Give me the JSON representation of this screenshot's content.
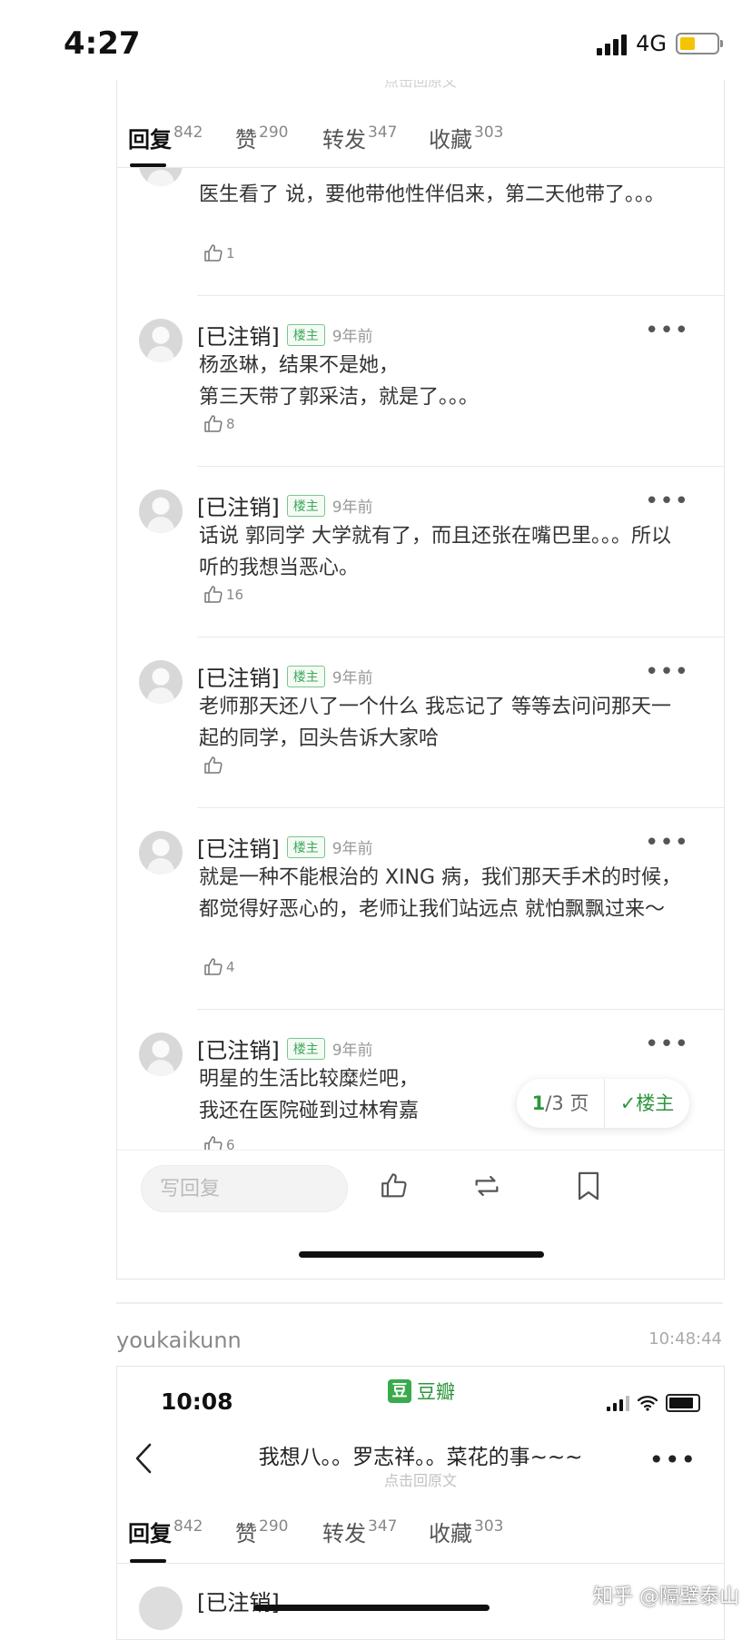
{
  "status_bar": {
    "time": "4:27",
    "network": "4G"
  },
  "ghost_link": "点击回原文",
  "tabs": [
    {
      "label": "回复",
      "count": "842"
    },
    {
      "label": "赞",
      "count": "290"
    },
    {
      "label": "转发",
      "count": "347"
    },
    {
      "label": "收藏",
      "count": "303"
    }
  ],
  "comments": [
    {
      "text": "医生看了 说，要他带他性伴侣来，第二天他带了。。。",
      "likes": "1"
    },
    {
      "name": "[已注销]",
      "badge": "楼主",
      "time": "9年前",
      "text": "杨丞琳，结果不是她，\n第三天带了郭采洁，就是了。。。",
      "likes": "8"
    },
    {
      "name": "[已注销]",
      "badge": "楼主",
      "time": "9年前",
      "text": "话说 郭同学 大学就有了，而且还张在嘴巴里。。。所以听的我想当恶心。",
      "likes": "16"
    },
    {
      "name": "[已注销]",
      "badge": "楼主",
      "time": "9年前",
      "text": "老师那天还八了一个什么 我忘记了 等等去问问那天一起的同学，回头告诉大家哈",
      "likes": ""
    },
    {
      "name": "[已注销]",
      "badge": "楼主",
      "time": "9年前",
      "text": "就是一种不能根治的 XING 病，我们那天手术的时候，都觉得好恶心的，老师让我们站远点 就怕飘飘过来～",
      "likes": "4"
    },
    {
      "name": "[已注销]",
      "badge": "楼主",
      "time": "9年前",
      "text": "明星的生活比较糜烂吧，\n我还在医院碰到过林宥嘉",
      "likes": "6"
    }
  ],
  "pager": {
    "current": "1",
    "total_text": "/3 页",
    "filter": "✓楼主"
  },
  "bottom_bar": {
    "reply_placeholder": "写回复"
  },
  "post": {
    "poster": "youkaikunn",
    "time": "10:48:44"
  },
  "second_screenshot": {
    "time": "10:08",
    "app_icon_char": "豆",
    "app_name": "豆瓣",
    "title": "我想八。。罗志祥。。菜花的事~~~",
    "subtitle": "点击回原文",
    "tabs": [
      {
        "label": "回复",
        "count": "842"
      },
      {
        "label": "赞",
        "count": "290"
      },
      {
        "label": "转发",
        "count": "347"
      },
      {
        "label": "收藏",
        "count": "303"
      }
    ],
    "first_comment_name": "[已注销]"
  },
  "watermark": "知乎 @隔壁泰山",
  "colors": {
    "accent_green": "#2e963d",
    "badge_green": "#3fa85a",
    "battery_yellow": "#f5c400"
  },
  "icons": [
    "signal-icon",
    "battery-icon",
    "thumb-up-icon",
    "repost-icon",
    "bookmark-icon",
    "back-chevron-icon",
    "more-dots-icon",
    "wifi-icon"
  ]
}
